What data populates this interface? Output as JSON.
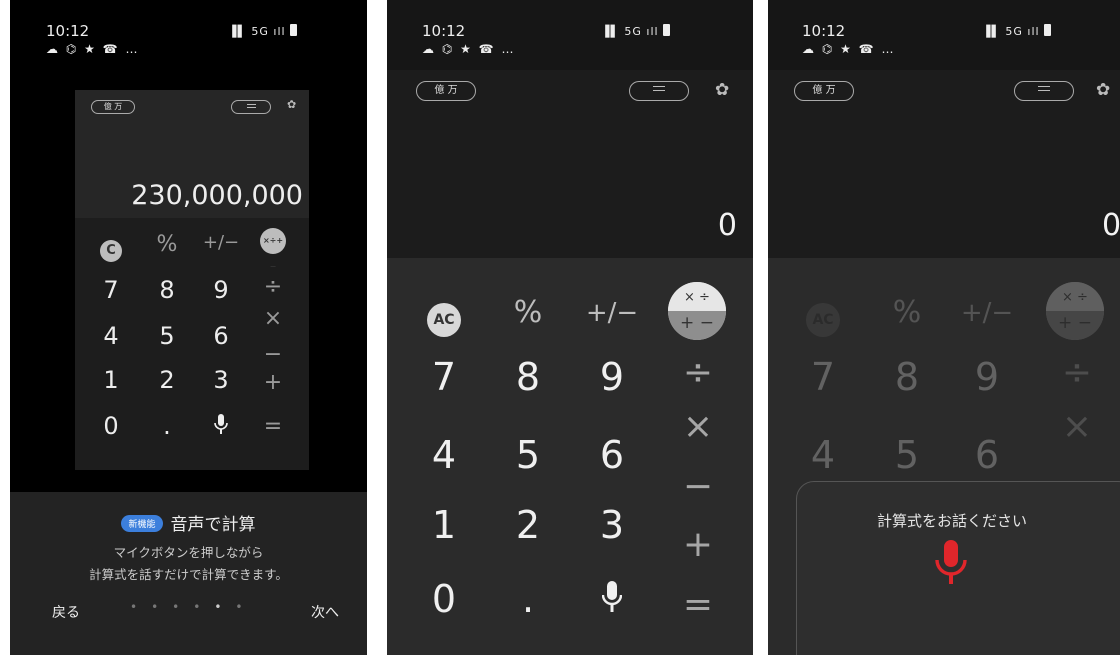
{
  "status": {
    "time": "10:12",
    "notifications": "☁ ⌬ ★ ☎ …",
    "system": "▐▌ 5G ıll"
  },
  "preview": {
    "unit_pill": "億 万",
    "display_value": "230,000,000",
    "keys": {
      "c": "C",
      "percent": "%",
      "plusminus": "+/−",
      "ops": "×÷+−",
      "div": "÷",
      "mul": "×",
      "minus": "−",
      "plus": "+",
      "equals": "=",
      "dot": "."
    }
  },
  "onboarding": {
    "badge": "新機能",
    "title": "音声で計算",
    "desc_line1": "マイクボタンを押しながら",
    "desc_line2": "計算式を話すだけで計算できます。",
    "back": "戻る",
    "next": "次へ",
    "page_count": 6,
    "current_page": 5
  },
  "calculator": {
    "unit_pill": "億 万",
    "display_value": "0",
    "keys": {
      "ac": "AC",
      "percent": "%",
      "plusminus": "+/−",
      "ops_top": "× ÷",
      "ops_bottom": "+ −",
      "div": "÷",
      "mul": "×",
      "minus": "−",
      "plus": "+",
      "equals": "=",
      "dot": ".",
      "d0": "0",
      "d1": "1",
      "d2": "2",
      "d3": "3",
      "d4": "4",
      "d5": "5",
      "d6": "6",
      "d7": "7",
      "d8": "8",
      "d9": "9"
    }
  },
  "voice": {
    "prompt": "計算式をお話ください"
  },
  "colors": {
    "mic_red": "#e0262b",
    "badge_blue": "#3c7fdc"
  }
}
